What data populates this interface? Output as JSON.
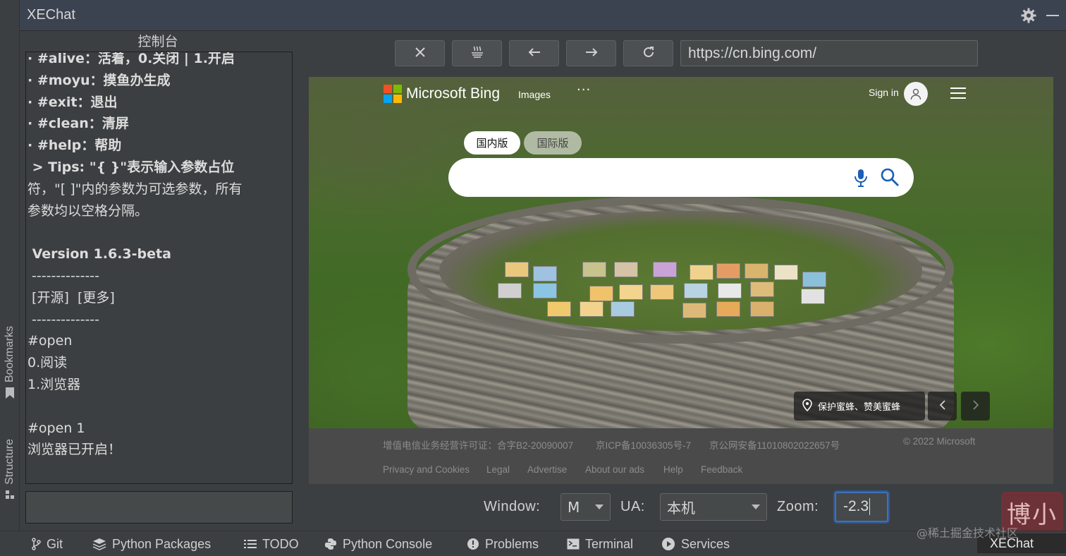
{
  "app": {
    "title": "XEChat"
  },
  "left_strip": {
    "bookmarks": "Bookmarks",
    "structure": "Structure"
  },
  "console": {
    "title": "控制台",
    "lines": [
      "· #alive：活着，0.关闭 | 1.开启",
      "· #moyu：摸鱼办生成",
      "· #exit：退出",
      "· #clean：清屏",
      "· #help：帮助",
      " > Tips: \"{ }\"表示输入参数占位",
      "符，\"[ ]\"内的参数为可选参数，所有",
      "参数均以空格分隔。",
      "",
      " Version 1.6.3-beta",
      " --------------",
      " [开源]  [更多]",
      " --------------",
      "#open",
      "0.阅读",
      "1.浏览器",
      "",
      "#open 1",
      "浏览器已开启！"
    ],
    "input_value": ""
  },
  "toolbar": {
    "url": "https://cn.bing.com/"
  },
  "bing": {
    "brand": "Microsoft Bing",
    "nav_images": "Images",
    "nav_more": "···",
    "sign_in": "Sign in",
    "tab_domestic": "国内版",
    "tab_international": "国际版",
    "search_value": "",
    "caption": "保护蜜蜂、赞美蜜蜂",
    "footer": {
      "license": "增值电信业务经营许可证：合字B2-20090007",
      "icp": "京ICP备10036305号-7",
      "police": "京公网安备11010802022657号",
      "copyright": "© 2022 Microsoft",
      "links": [
        "Privacy and Cookies",
        "Legal",
        "Advertise",
        "About our ads",
        "Help",
        "Feedback"
      ]
    }
  },
  "controls": {
    "window_label": "Window:",
    "window_value": "M",
    "ua_label": "UA:",
    "ua_value": "本机",
    "zoom_label": "Zoom:",
    "zoom_value": "-2.3"
  },
  "statusbar": {
    "items": [
      "Git",
      "Python Packages",
      "TODO",
      "Python Console",
      "Problems",
      "Terminal",
      "Services"
    ],
    "active_tab": "XEChat",
    "watermark": "@稀土掘金技术社区",
    "stamp": "博小"
  },
  "colors": {
    "accent_focus": "#3f72b7",
    "header_bg": "#3c4350",
    "ide_bg": "#3c3f41"
  }
}
